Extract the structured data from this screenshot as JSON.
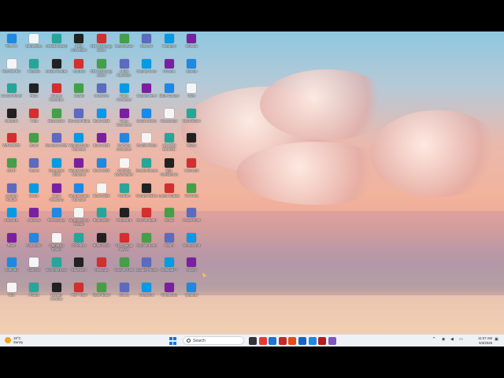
{
  "desktop": {
    "columns": [
      [
        "This PC",
        "Recycle Bin",
        "Control Panel",
        "Network",
        "WINWORD",
        "GIMP",
        "Acrobat Reader",
        "Inkscape",
        "Paint",
        "Notepad",
        "VLC"
      ],
      [
        "EdrawMax",
        "FileZilla",
        "Putty",
        "7-Zip",
        "Zoom",
        "Teams",
        "Skype",
        "Audacity",
        "Calculator",
        "Camera",
        "Photos"
      ],
      [
        "AOMEI Switch",
        "Adobe Reader",
        "Screen Recorder",
        "Bluestacks",
        "Camtasia 2025",
        "Screenrec 2025",
        "Zoom Meetings",
        "PDFescape",
        "Camtasia Studio",
        "Screenpresso",
        "Google Chrome"
      ],
      [
        "IOBit Uninstaller",
        "Acrobat",
        "Snagit",
        "Microsoft Edge",
        "Wondershare Manager",
        "Wondershare Manager",
        "Wondershare Manager",
        "Wondershare Repair",
        "CCleaner",
        "Edge Dev",
        "PDF Tools"
      ],
      [
        "PDF-XChange Editor",
        "PDF-XChange Editor",
        "OneDrive",
        "Book 2025",
        "Book 2025",
        "Book 2025",
        "Book 2025",
        "Book 2024",
        "Book 2024",
        "Inkscape",
        "Style Editor"
      ],
      [
        "TeamViewer",
        "Audio Recorder",
        "Video Converter",
        "Video Converter",
        "YouTube Converter",
        "YouTube Downloader",
        "YouPlay",
        "Whatsapp",
        "VLC media player",
        "Google Chat",
        "Canva"
      ],
      [
        "Discord",
        "Google Docs",
        "Google Meet",
        "Google Drive",
        "Google Maps",
        "Google Sheets",
        "Google Slides",
        "Google Earth",
        "Google Keep",
        "Google Photos",
        "Snapshot"
      ],
      [
        "Telegram",
        "Chrome",
        "Edge Canary",
        "Messenger",
        "AR WEB DESIGN",
        "SQL Workbench",
        "Latest Update",
        "Gmail",
        "Steam",
        "Notepad++",
        "WhatsApp"
      ],
      [
        "Outlook",
        "Xampp",
        "Viber",
        "Word Editor",
        "Skype",
        "Microsoft",
        "VS Code",
        "PowerPoint",
        "Screenshot",
        "Spotify",
        "Snapper"
      ]
    ],
    "col_colors": [
      "#1e88e5",
      "#f5f5f5",
      "#26a69a",
      "#212121",
      "#d32f2f",
      "#43a047",
      "#5c6bc0",
      "#039be5",
      "#7b1fa2"
    ]
  },
  "taskbar": {
    "weather_temp": "19°C",
    "weather_cond": "Sunny",
    "search_placeholder": "Search",
    "clock_time": "11:07 AM",
    "clock_date": "6/3/2025",
    "tray_arrow": "^",
    "apps": [
      {
        "name": "file-explorer",
        "color": "#333333"
      },
      {
        "name": "chrome",
        "color": "#e53935"
      },
      {
        "name": "edge",
        "color": "#1976d2"
      },
      {
        "name": "pdf-app",
        "color": "#c62828"
      },
      {
        "name": "wps",
        "color": "#e64a19"
      },
      {
        "name": "wondershare",
        "color": "#1565c0"
      },
      {
        "name": "word",
        "color": "#1e88e5"
      },
      {
        "name": "acrobat",
        "color": "#b71c1c"
      },
      {
        "name": "viber",
        "color": "#7e57c2"
      }
    ]
  }
}
